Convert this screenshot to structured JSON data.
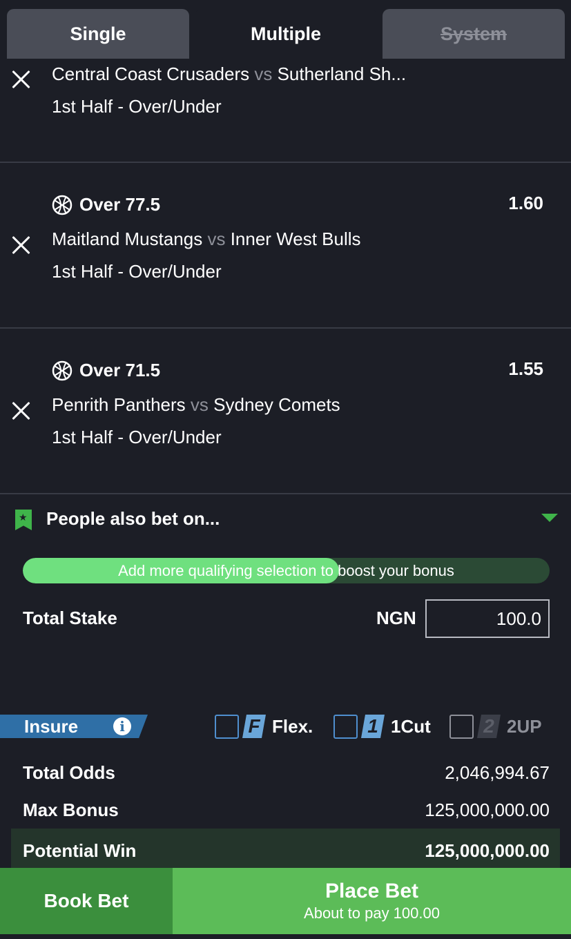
{
  "tabs": {
    "single": "Single",
    "multiple": "Multiple",
    "system": "System"
  },
  "selections": [
    {
      "pick": "",
      "odds": "",
      "home": "Central Coast Crusaders",
      "vs": "vs",
      "away": "Sutherland Sh...",
      "market": "1st Half - Over/Under"
    },
    {
      "pick": "Over 77.5",
      "odds": "1.60",
      "home": "Maitland Mustangs",
      "vs": "vs",
      "away": "Inner West Bulls",
      "market": "1st Half - Over/Under"
    },
    {
      "pick": "Over 71.5",
      "odds": "1.55",
      "home": "Penrith Panthers",
      "vs": "vs",
      "away": "Sydney Comets",
      "market": "1st Half - Over/Under"
    }
  ],
  "people_also_bet": "People also bet on...",
  "boost": {
    "label": "Add more qualifying selection to boost your bonus",
    "progress": 0.6
  },
  "stake": {
    "label": "Total Stake",
    "currency": "NGN",
    "value": "100.0"
  },
  "insure": {
    "label": "Insure",
    "info_icon": "i"
  },
  "options": [
    {
      "badge": "F",
      "label": "Flex."
    },
    {
      "badge": "1",
      "label": "1Cut"
    },
    {
      "badge": "2",
      "label": "2UP"
    }
  ],
  "summary": {
    "total_odds_label": "Total Odds",
    "total_odds": "2,046,994.67",
    "max_bonus_label": "Max Bonus",
    "max_bonus": "125,000,000.00",
    "potential_win_label": "Potential Win",
    "potential_win": "125,000,000.00"
  },
  "actions": {
    "book": "Book Bet",
    "place": "Place Bet",
    "pay": "About to pay 100.00"
  },
  "colors": {
    "accent_green": "#5cbc58",
    "dark_green": "#3b8f3d",
    "bg": "#1c1e26",
    "insure_blue": "#2f6fa6"
  }
}
